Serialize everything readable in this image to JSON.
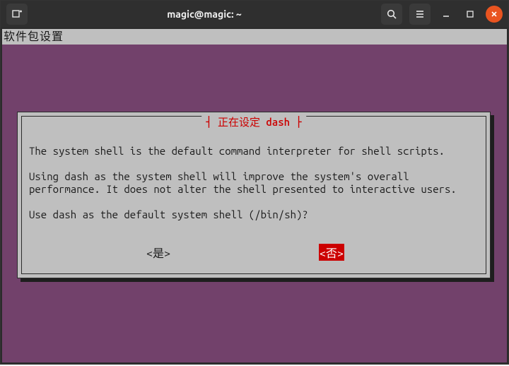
{
  "titlebar": {
    "title": "magic@magic: ~",
    "new_tab_icon": "new-tab-icon",
    "search_icon": "search-icon",
    "menu_icon": "menu-icon",
    "minimize_icon": "minimize-icon",
    "maximize_icon": "maximize-icon",
    "close_icon": "close-icon"
  },
  "terminal": {
    "package_header": "软件包设置"
  },
  "dialog": {
    "title": "┤ 正在设定 dash ├",
    "para1": "The system shell is the default command interpreter for shell scripts.",
    "para2": "Using dash as the system shell will improve the system's overall performance. It does not alter the shell presented to interactive users.",
    "question": "Use dash as the default system shell (/bin/sh)?",
    "yes_label": "<是>",
    "no_label": "<否>",
    "selected": "no"
  }
}
